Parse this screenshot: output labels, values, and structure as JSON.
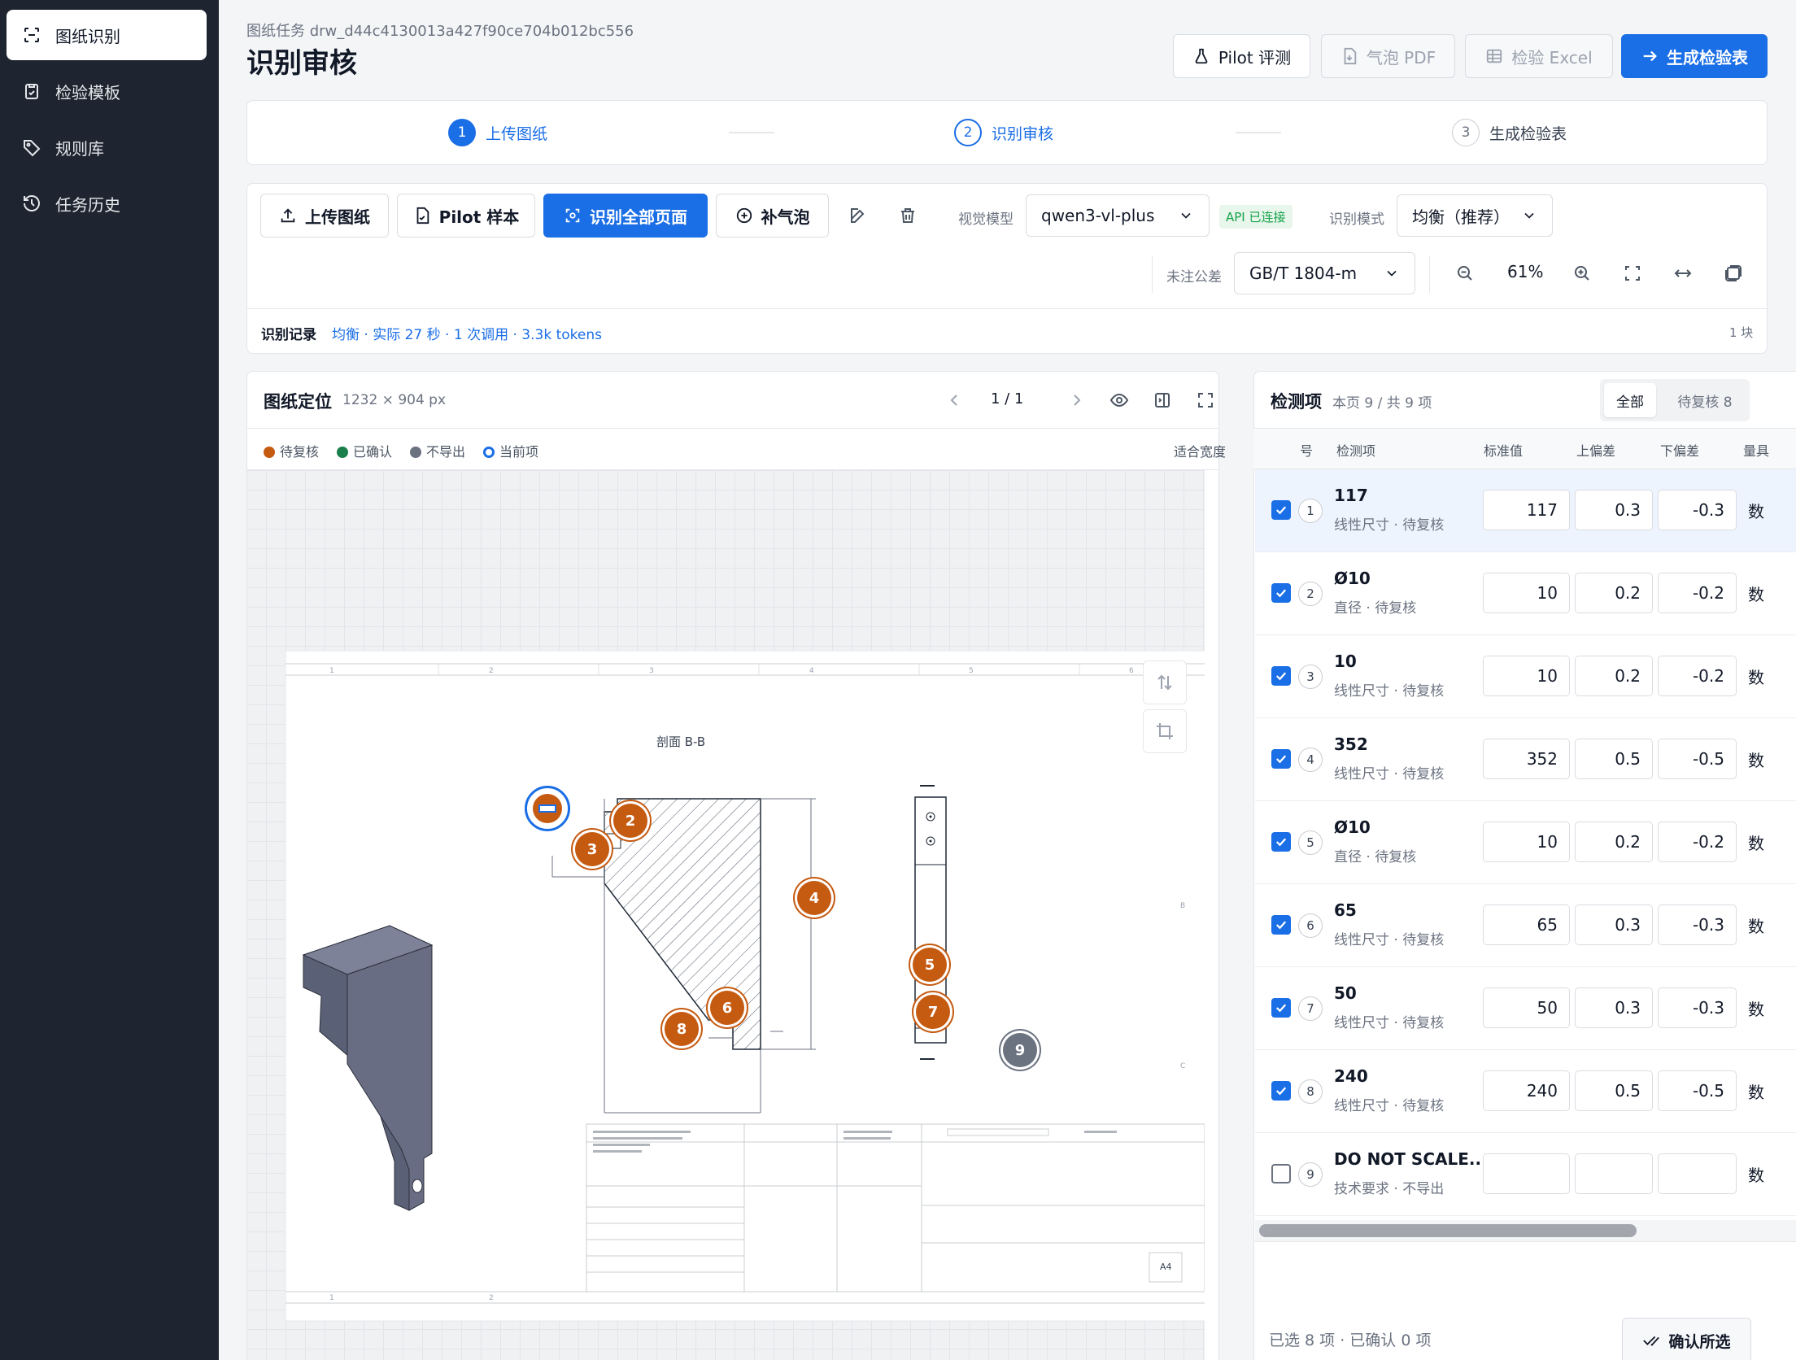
{
  "sidebar": {
    "items": [
      {
        "label": "图纸识别",
        "icon": "scan-icon"
      },
      {
        "label": "检验模板",
        "icon": "clipboard-icon"
      },
      {
        "label": "规则库",
        "icon": "tag-icon"
      },
      {
        "label": "任务历史",
        "icon": "history-icon"
      }
    ]
  },
  "header": {
    "subtitle": "图纸任务 drw_d44c4130013a427f90ce704b012bc556",
    "title": "识别审核",
    "buttons": {
      "pilot_eval": "Pilot 评测",
      "bubble_pdf": "气泡 PDF",
      "inspect_excel": "检验 Excel",
      "generate": "生成检验表"
    }
  },
  "steps": [
    {
      "num": "1",
      "label": "上传图纸"
    },
    {
      "num": "2",
      "label": "识别审核"
    },
    {
      "num": "3",
      "label": "生成检验表"
    }
  ],
  "toolbar": {
    "upload": "上传图纸",
    "pilot_sample": "Pilot 样本",
    "recognize_all": "识别全部页面",
    "add_bubble": "补气泡",
    "vision_model_label": "视觉模型",
    "vision_model_value": "qwen3-vl-plus",
    "api_status": "API 已连接",
    "mode_label": "识别模式",
    "mode_value": "均衡（推荐）",
    "tolerance_label": "未注公差",
    "tolerance_value": "GB/T 1804-m",
    "zoom": "61%",
    "record_label": "识别记录",
    "record_value": "均衡 · 实际 27 秒 · 1 次调用 · 3.3k tokens",
    "record_count": "1 块"
  },
  "drawing": {
    "title": "图纸定位",
    "size": "1232 × 904 px",
    "page": "1 / 1",
    "fit": "适合宽度",
    "legend": [
      {
        "label": "待复核",
        "color": "#c55a11"
      },
      {
        "label": "已确认",
        "color": "#1a7f4b"
      },
      {
        "label": "不导出",
        "color": "#6b7280"
      },
      {
        "label": "当前项",
        "color": "#1a6ee6"
      }
    ],
    "section_label": "剖面 B-B",
    "sheet_size": "A4",
    "bubbles": [
      "2",
      "3",
      "4",
      "5",
      "6",
      "7",
      "8",
      "9"
    ]
  },
  "items": {
    "title": "检测项",
    "count": "本页 9 / 共 9 项",
    "tabs": {
      "all": "全部",
      "pending": "待复核 8"
    },
    "columns": [
      "号",
      "检测项",
      "标准值",
      "上偏差",
      "下偏差",
      "量具"
    ],
    "rows": [
      {
        "n": "1",
        "name": "117",
        "sub": "线性尺寸 · 待复核",
        "nominal": "117",
        "upper": "0.3",
        "lower": "-0.3",
        "tail": "数",
        "checked": true
      },
      {
        "n": "2",
        "name": "Ø10",
        "sub": "直径 · 待复核",
        "nominal": "10",
        "upper": "0.2",
        "lower": "-0.2",
        "tail": "数",
        "checked": true
      },
      {
        "n": "3",
        "name": "10",
        "sub": "线性尺寸 · 待复核",
        "nominal": "10",
        "upper": "0.2",
        "lower": "-0.2",
        "tail": "数",
        "checked": true
      },
      {
        "n": "4",
        "name": "352",
        "sub": "线性尺寸 · 待复核",
        "nominal": "352",
        "upper": "0.5",
        "lower": "-0.5",
        "tail": "数",
        "checked": true
      },
      {
        "n": "5",
        "name": "Ø10",
        "sub": "直径 · 待复核",
        "nominal": "10",
        "upper": "0.2",
        "lower": "-0.2",
        "tail": "数",
        "checked": true
      },
      {
        "n": "6",
        "name": "65",
        "sub": "线性尺寸 · 待复核",
        "nominal": "65",
        "upper": "0.3",
        "lower": "-0.3",
        "tail": "数",
        "checked": true
      },
      {
        "n": "7",
        "name": "50",
        "sub": "线性尺寸 · 待复核",
        "nominal": "50",
        "upper": "0.3",
        "lower": "-0.3",
        "tail": "数",
        "checked": true
      },
      {
        "n": "8",
        "name": "240",
        "sub": "线性尺寸 · 待复核",
        "nominal": "240",
        "upper": "0.5",
        "lower": "-0.5",
        "tail": "数",
        "checked": true
      },
      {
        "n": "9",
        "name": "DO NOT SCALE...",
        "sub": "技术要求 · 不导出",
        "nominal": "",
        "upper": "",
        "lower": "",
        "tail": "数",
        "checked": false
      }
    ],
    "footer_status": "已选 8 项 · 已确认 0 项",
    "confirm": "确认所选"
  }
}
